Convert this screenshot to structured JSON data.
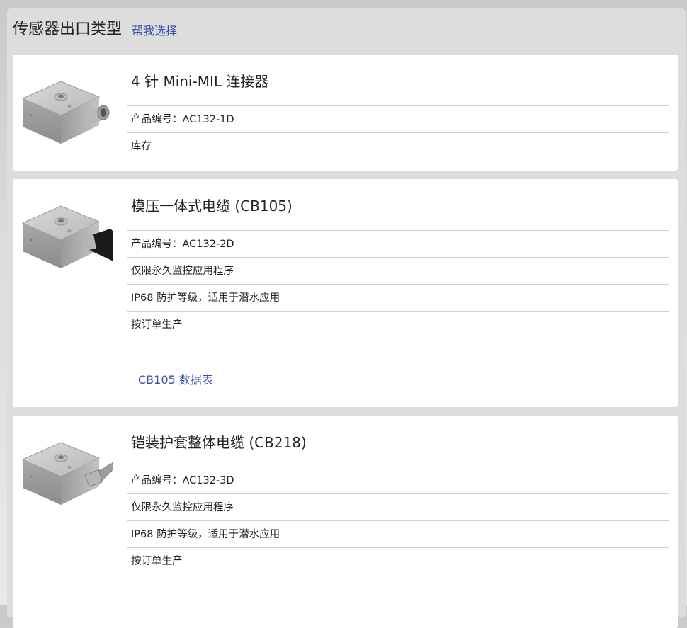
{
  "header": {
    "title": "传感器出口类型",
    "help_link": "帮我选择"
  },
  "products": [
    {
      "title": "4 针 Mini-MIL 连接器",
      "image_icon": "sensor-connector-icon",
      "rows": [
        "产品编号：AC132-1D",
        "库存"
      ]
    },
    {
      "title": "模压一体式电缆 (CB105)",
      "image_icon": "sensor-molded-cable-icon",
      "rows": [
        "产品编号：AC132-2D",
        "仅限永久监控应用程序",
        "IP68 防护等级，适用于潜水应用",
        "按订单生产"
      ],
      "datasheet": "CB105 数据表"
    },
    {
      "title": "铠装护套整体电缆 (CB218)",
      "image_icon": "sensor-armored-cable-icon",
      "rows": [
        "产品编号：AC132-3D",
        "仅限永久监控应用程序",
        "IP68 防护等级，适用于潜水应用",
        "按订单生产"
      ]
    }
  ],
  "colors": {
    "link": "#3c4fa8",
    "panel": "#dddddd",
    "card": "#ffffff"
  }
}
